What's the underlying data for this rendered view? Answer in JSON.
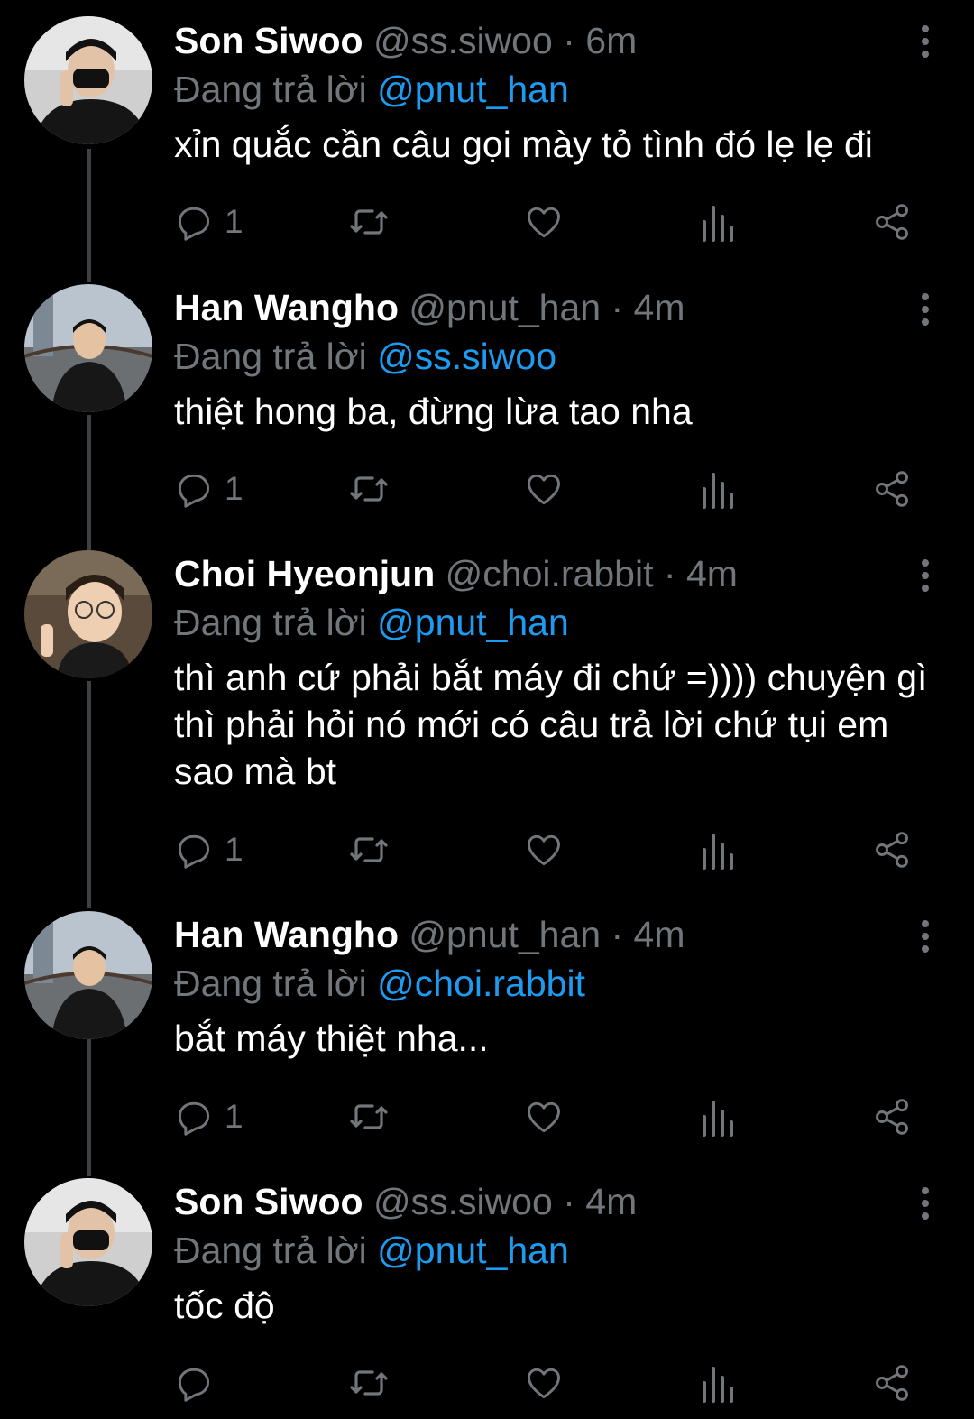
{
  "tweets": [
    {
      "name": "Son Siwoo",
      "handle": "@ss.siwoo",
      "time": "6m",
      "reply_prefix": "Đang trả lời",
      "reply_to": "@pnut_han",
      "text": "xỉn quắc cần câu gọi mày tỏ tình đó lẹ lẹ đi",
      "reply_count": "1",
      "avatar": "son-siwoo"
    },
    {
      "name": "Han Wangho",
      "handle": "@pnut_han",
      "time": "4m",
      "reply_prefix": "Đang trả lời",
      "reply_to": "@ss.siwoo",
      "text": "thiệt hong ba, đừng lừa tao nha",
      "reply_count": "1",
      "avatar": "han-wangho"
    },
    {
      "name": "Choi Hyeonjun",
      "handle": "@choi.rabbit",
      "time": "4m",
      "reply_prefix": "Đang trả lời",
      "reply_to": "@pnut_han",
      "text": "thì anh cứ phải bắt máy đi chứ =)))) chuyện gì thì phải hỏi nó mới có câu trả lời chứ tụi em sao mà bt",
      "reply_count": "1",
      "avatar": "choi-hyeonjun"
    },
    {
      "name": "Han Wangho",
      "handle": "@pnut_han",
      "time": "4m",
      "reply_prefix": "Đang trả lời",
      "reply_to": "@choi.rabbit",
      "text": "bắt máy thiệt nha...",
      "reply_count": "1",
      "avatar": "han-wangho"
    },
    {
      "name": "Son Siwoo",
      "handle": "@ss.siwoo",
      "time": "4m",
      "reply_prefix": "Đang trả lời",
      "reply_to": "@pnut_han",
      "text": "tốc độ",
      "reply_count": "",
      "avatar": "son-siwoo"
    }
  ],
  "icons": {
    "reply": "reply-icon",
    "retweet": "retweet-icon",
    "like": "like-icon",
    "views": "views-icon",
    "share": "share-icon",
    "more": "more-icon"
  },
  "colors": {
    "background": "#000000",
    "muted": "#71767b",
    "mention": "#1d9bf0",
    "thread_line": "#3e4144"
  }
}
